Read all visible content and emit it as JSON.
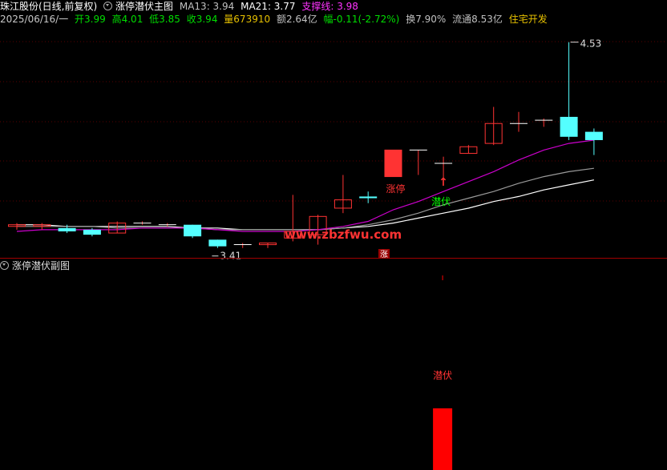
{
  "header": {
    "stock_name": "珠江股份(日线,前复权)",
    "indicator_name": "涨停潜伏主图",
    "ma13_label": "MA13: 3.94",
    "ma21_label": "MA21: 3.77",
    "support_label": "支撑线: 3.98"
  },
  "quote": {
    "date": "2025/06/16/一",
    "open": "开3.99",
    "high": "高4.01",
    "low": "低3.85",
    "close": "收3.94",
    "volume": "量673910",
    "amount": "额2.64亿",
    "change": "幅-0.11(-2.72%)",
    "turnover": "换7.90%",
    "float_shares": "流通8.53亿",
    "sector": "住宅开发"
  },
  "annotations": {
    "high_marker": "4.53",
    "low_marker": "3.41",
    "limit_up_label": "涨停",
    "lurk_label": "潜伏",
    "watermark": "www.zbzfwu.com",
    "limit_badge": "涨"
  },
  "sub_chart": {
    "title": "涨停潜伏副图",
    "lurk_label": "潜伏"
  },
  "colors": {
    "up": "#ff3333",
    "down": "#54ffff",
    "ma13": "#cc00cc",
    "ma21": "#9a9a9a",
    "support": "#ffffff",
    "subbar": "#ff0000"
  },
  "chart_data": {
    "type": "candlestick",
    "dates_visible": [
      "2025/06/16"
    ],
    "candles": [
      {
        "open": 3.42,
        "high": 3.44,
        "low": 3.4,
        "close": 3.43
      },
      {
        "open": 3.42,
        "high": 3.44,
        "low": 3.4,
        "close": 3.43
      },
      {
        "open": 3.41,
        "high": 3.43,
        "low": 3.38,
        "close": 3.39
      },
      {
        "open": 3.4,
        "high": 3.41,
        "low": 3.36,
        "close": 3.37
      },
      {
        "open": 3.38,
        "high": 3.45,
        "low": 3.38,
        "close": 3.44
      },
      {
        "open": 3.44,
        "high": 3.45,
        "low": 3.43,
        "close": 3.44
      },
      {
        "open": 3.43,
        "high": 3.44,
        "low": 3.42,
        "close": 3.43
      },
      {
        "open": 3.43,
        "high": 3.43,
        "low": 3.35,
        "close": 3.36
      },
      {
        "open": 3.34,
        "high": 3.34,
        "low": 3.29,
        "close": 3.3
      },
      {
        "open": 3.31,
        "high": 3.32,
        "low": 3.29,
        "close": 3.31
      },
      {
        "open": 3.31,
        "high": 3.32,
        "low": 3.29,
        "close": 3.32
      },
      {
        "open": 3.35,
        "high": 3.61,
        "low": 3.33,
        "close": 3.39
      },
      {
        "open": 3.37,
        "high": 3.49,
        "low": 3.31,
        "close": 3.48
      },
      {
        "open": 3.53,
        "high": 3.73,
        "low": 3.5,
        "close": 3.58
      },
      {
        "open": 3.6,
        "high": 3.63,
        "low": 3.56,
        "close": 3.59
      },
      {
        "open": 3.72,
        "high": 3.88,
        "low": 3.72,
        "close": 3.88
      },
      {
        "open": 3.88,
        "high": 3.88,
        "low": 3.73,
        "close": 3.88
      },
      {
        "open": 3.8,
        "high": 3.84,
        "low": 3.7,
        "close": 3.8
      },
      {
        "open": 3.86,
        "high": 3.91,
        "low": 3.86,
        "close": 3.9
      },
      {
        "open": 3.92,
        "high": 4.14,
        "low": 3.91,
        "close": 4.04
      },
      {
        "open": 4.04,
        "high": 4.11,
        "low": 3.99,
        "close": 4.04
      },
      {
        "open": 4.06,
        "high": 4.07,
        "low": 4.02,
        "close": 4.06
      },
      {
        "open": 4.08,
        "high": 4.53,
        "low": 3.94,
        "close": 3.96
      },
      {
        "open": 3.99,
        "high": 4.01,
        "low": 3.85,
        "close": 3.94
      }
    ],
    "ma13": [
      3.39,
      3.4,
      3.4,
      3.4,
      3.4,
      3.41,
      3.41,
      3.41,
      3.4,
      3.39,
      3.39,
      3.39,
      3.4,
      3.42,
      3.45,
      3.52,
      3.57,
      3.63,
      3.69,
      3.75,
      3.82,
      3.88,
      3.92,
      3.94
    ],
    "ma21": [
      3.42,
      3.42,
      3.42,
      3.42,
      3.41,
      3.41,
      3.41,
      3.41,
      3.4,
      3.4,
      3.4,
      3.4,
      3.4,
      3.41,
      3.43,
      3.46,
      3.5,
      3.55,
      3.59,
      3.63,
      3.68,
      3.72,
      3.75,
      3.77
    ],
    "support": [
      3.43,
      3.43,
      3.42,
      3.42,
      3.42,
      3.42,
      3.42,
      3.41,
      3.41,
      3.4,
      3.4,
      3.4,
      3.4,
      3.41,
      3.42,
      3.44,
      3.47,
      3.5,
      3.53,
      3.57,
      3.6,
      3.64,
      3.67,
      3.7
    ],
    "ylim": [
      3.25,
      4.62
    ],
    "sub_bars": [
      {
        "index": 17,
        "value": 1
      }
    ]
  }
}
